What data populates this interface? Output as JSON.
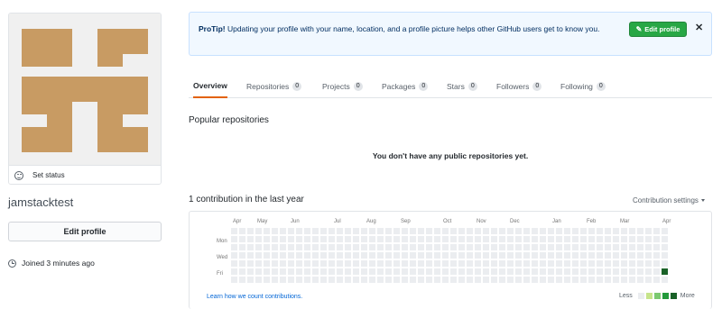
{
  "profile": {
    "username": "jamstacktest",
    "set_status": "Set status",
    "edit_profile": "Edit profile",
    "joined": "Joined 3 minutes ago",
    "avatar_color": "#c89b63"
  },
  "protip": {
    "label": "ProTip!",
    "message": "Updating your profile with your name, location, and a profile picture helps other GitHub users get to know you.",
    "button": "Edit profile",
    "close": "✕"
  },
  "tabs": [
    {
      "label": "Overview",
      "count": null,
      "selected": true
    },
    {
      "label": "Repositories",
      "count": "0"
    },
    {
      "label": "Projects",
      "count": "0"
    },
    {
      "label": "Packages",
      "count": "0"
    },
    {
      "label": "Stars",
      "count": "0"
    },
    {
      "label": "Followers",
      "count": "0"
    },
    {
      "label": "Following",
      "count": "0"
    }
  ],
  "popular": {
    "title": "Popular repositories",
    "empty": "You don't have any public repositories yet."
  },
  "contributions": {
    "title": "1 contribution in the last year",
    "settings": "Contribution settings",
    "months": [
      "Apr",
      "May",
      "Jun",
      "Jul",
      "Aug",
      "Sep",
      "Oct",
      "Nov",
      "Dec",
      "Jan",
      "Feb",
      "Mar",
      "Apr"
    ],
    "weekdays": [
      "Mon",
      "Wed",
      "Fri"
    ],
    "learn": "Learn how we count contributions.",
    "less": "Less",
    "more": "More",
    "colors": [
      "#ebedf0",
      "#c6e48b",
      "#7bc96f",
      "#239a3b",
      "#196127"
    ],
    "contribution_days": [
      {
        "week": 53,
        "day": 5,
        "level": 4
      }
    ]
  }
}
